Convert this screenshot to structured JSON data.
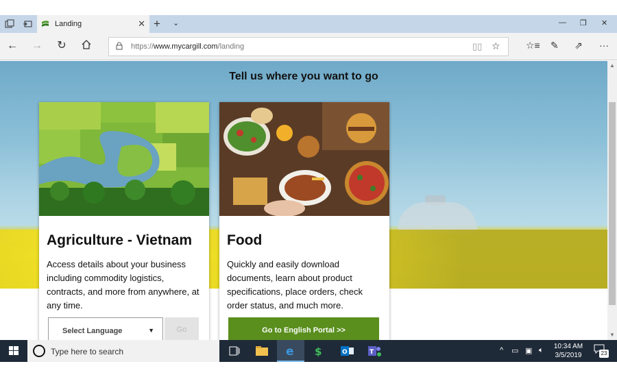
{
  "browser": {
    "tab_title": "Landing",
    "url_prefix": "https://",
    "url_domain": "www.mycargill.com",
    "url_path": "/landing"
  },
  "page": {
    "headline": "Tell us where you want to go",
    "cards": [
      {
        "title": "Agriculture - Vietnam",
        "description": "Access details about your business including commodity logistics, contracts, and more from anywhere, at any time.",
        "select_placeholder": "Select Language",
        "go_label": "Go"
      },
      {
        "title": "Food",
        "description": "Quickly and easily download documents, learn about product specifications, place orders, check order status, and much more.",
        "button_label": "Go to English Portal >>"
      }
    ]
  },
  "taskbar": {
    "search_placeholder": "Type here to search",
    "time": "10:34 AM",
    "date": "3/5/2019",
    "notification_count": "23"
  },
  "colors": {
    "portal_button": "#5a8f1e",
    "taskbar": "#1f2a38",
    "tabbar": "#c5d6e8"
  }
}
